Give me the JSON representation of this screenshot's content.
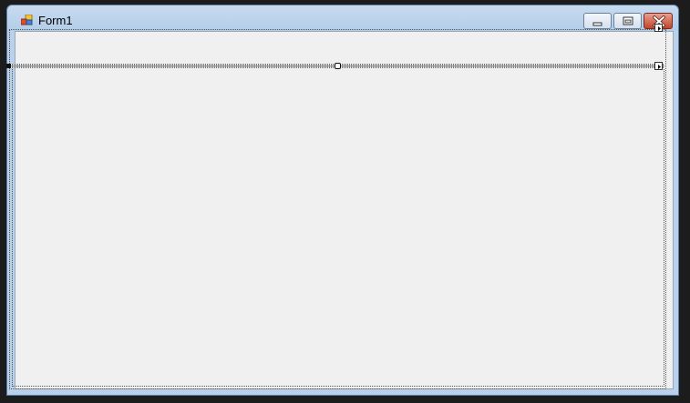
{
  "window": {
    "title": "Form1",
    "icon": "form-icon",
    "controls": {
      "minimize": "minimize-icon",
      "maximize": "maximize-icon",
      "close": "close-icon"
    }
  },
  "designer": {
    "smart_tag_icon": "smart-tag-arrow-icon"
  },
  "colors": {
    "titlebar": "#b9d1ea",
    "client_background": "#f0f0f0",
    "close_button": "#c2452b",
    "desktop": "#1c1c1c"
  }
}
